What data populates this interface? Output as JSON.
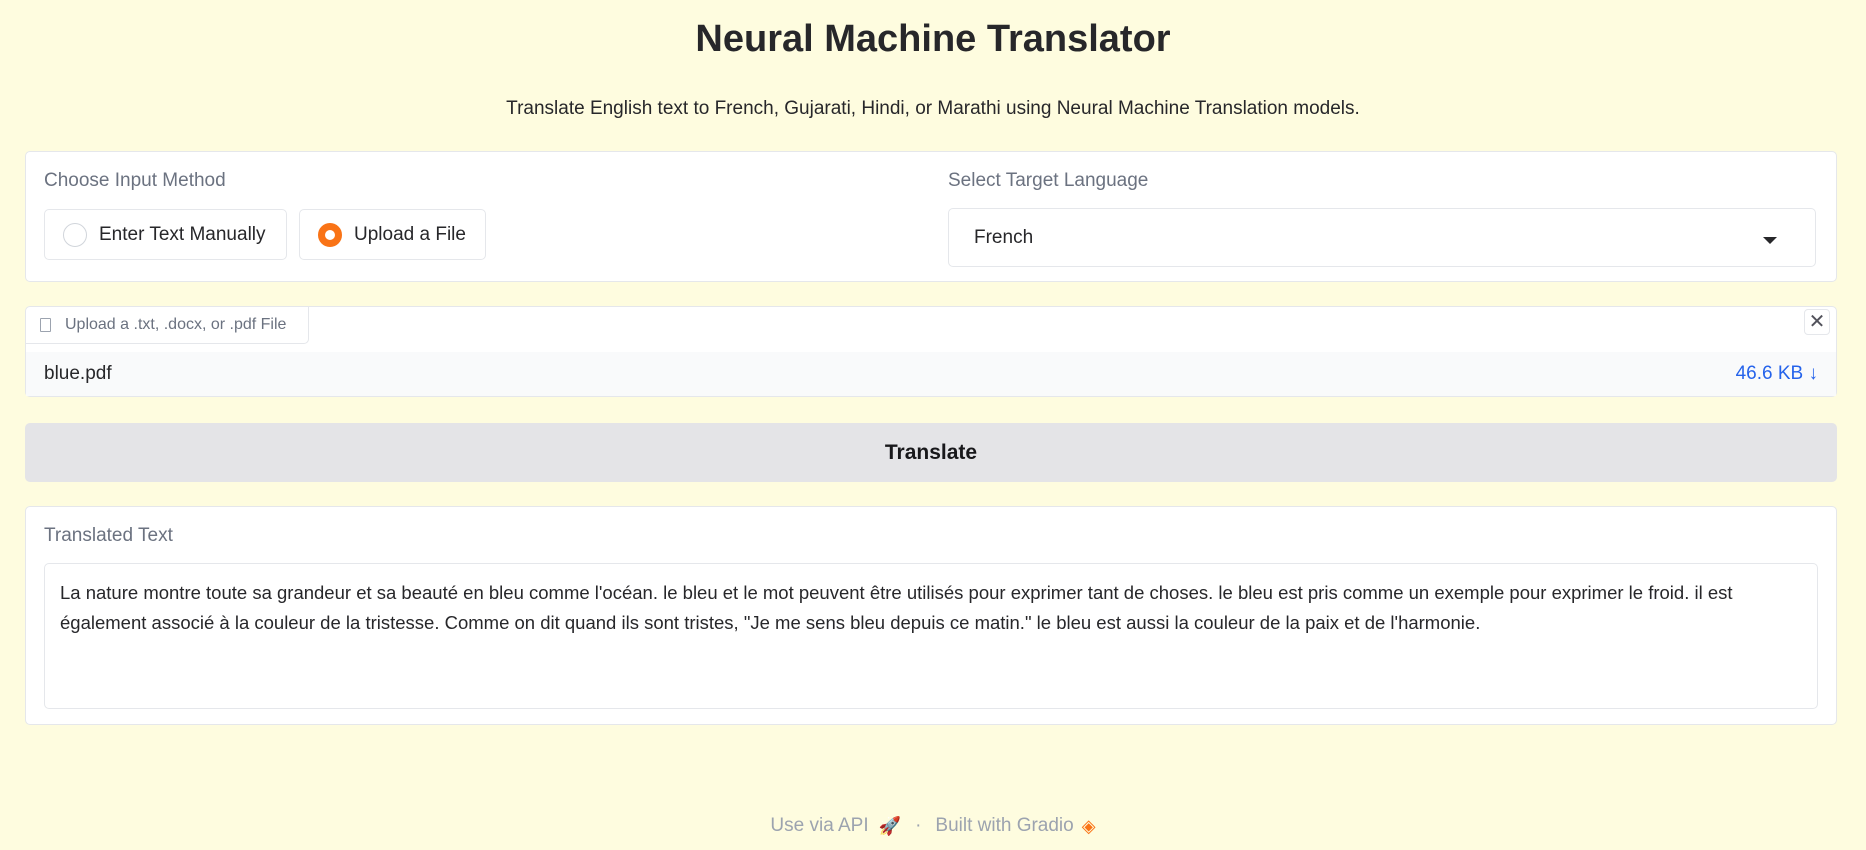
{
  "header": {
    "title": "Neural Machine Translator",
    "subtitle": "Translate English text to French, Gujarati, Hindi, or Marathi using Neural Machine Translation models."
  },
  "input_method": {
    "label": "Choose Input Method",
    "options": [
      {
        "label": "Enter Text Manually",
        "selected": false
      },
      {
        "label": "Upload a File",
        "selected": true
      }
    ]
  },
  "target_language": {
    "label": "Select Target Language",
    "value": "French"
  },
  "file_upload": {
    "label": "Upload a .txt, .docx, or .pdf File",
    "file_name": "blue.pdf",
    "file_size": "46.6 KB ↓"
  },
  "translate_button": {
    "label": "Translate"
  },
  "output": {
    "label": "Translated Text",
    "text": "La nature montre toute sa grandeur et sa beauté en bleu comme l'océan. le bleu et le mot peuvent être utilisés pour exprimer tant de choses. le bleu est pris comme un exemple pour exprimer le froid. il est également associé à la couleur de la tristesse. Comme on dit quand ils sont tristes, \"Je me sens bleu depuis ce matin.\" le bleu est aussi la couleur de la paix et de l'harmonie."
  },
  "footer": {
    "api_label": "Use via API",
    "separator": "·",
    "built_label": "Built with Gradio"
  },
  "colors": {
    "background": "#fefcdf",
    "accent": "#f97316",
    "link": "#2563eb"
  }
}
